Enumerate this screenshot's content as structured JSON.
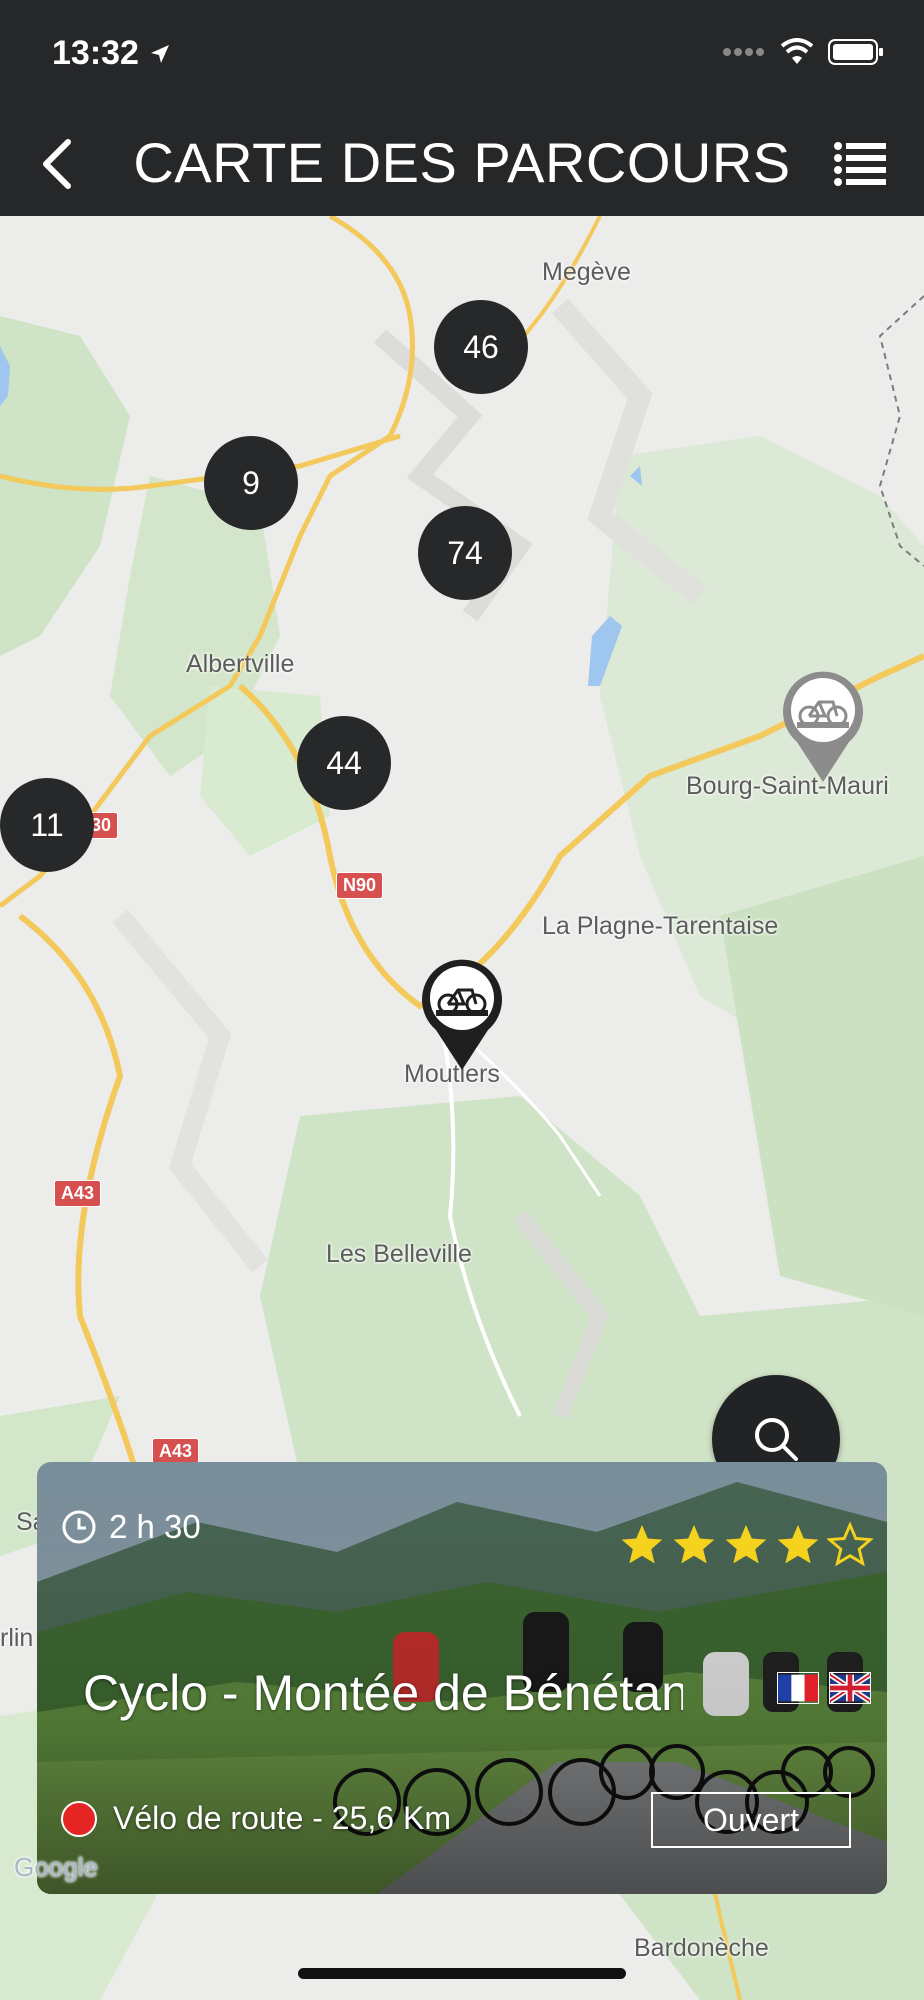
{
  "status": {
    "time": "13:32"
  },
  "nav": {
    "title": "CARTE DES PARCOURS",
    "back_icon": "chevron-left-icon",
    "menu_icon": "list-icon"
  },
  "map": {
    "places": [
      "Megève",
      "Albertville",
      "Bourg-Saint-Mauri",
      "La Plagne-Tarentaise",
      "Moutiers",
      "Les Belleville",
      "Bardonèche",
      "Sa",
      "rlin"
    ],
    "road_labels": [
      "30",
      "N90",
      "A43",
      "A43"
    ],
    "clusters": [
      "46",
      "9",
      "74",
      "44",
      "11"
    ]
  },
  "search": {
    "icon": "search-icon"
  },
  "card": {
    "duration": "2 h 30",
    "rating": 4,
    "rating_max": 5,
    "title": "Cyclo - Montée de Bénétan",
    "languages": [
      "fr",
      "en"
    ],
    "subtitle": "Vélo de route - 25,6 Km",
    "status": "Ouvert",
    "status_color": "#e52424"
  },
  "colors": {
    "bar": "#262729",
    "cluster": "#27282a",
    "star": "#f5d21e"
  }
}
